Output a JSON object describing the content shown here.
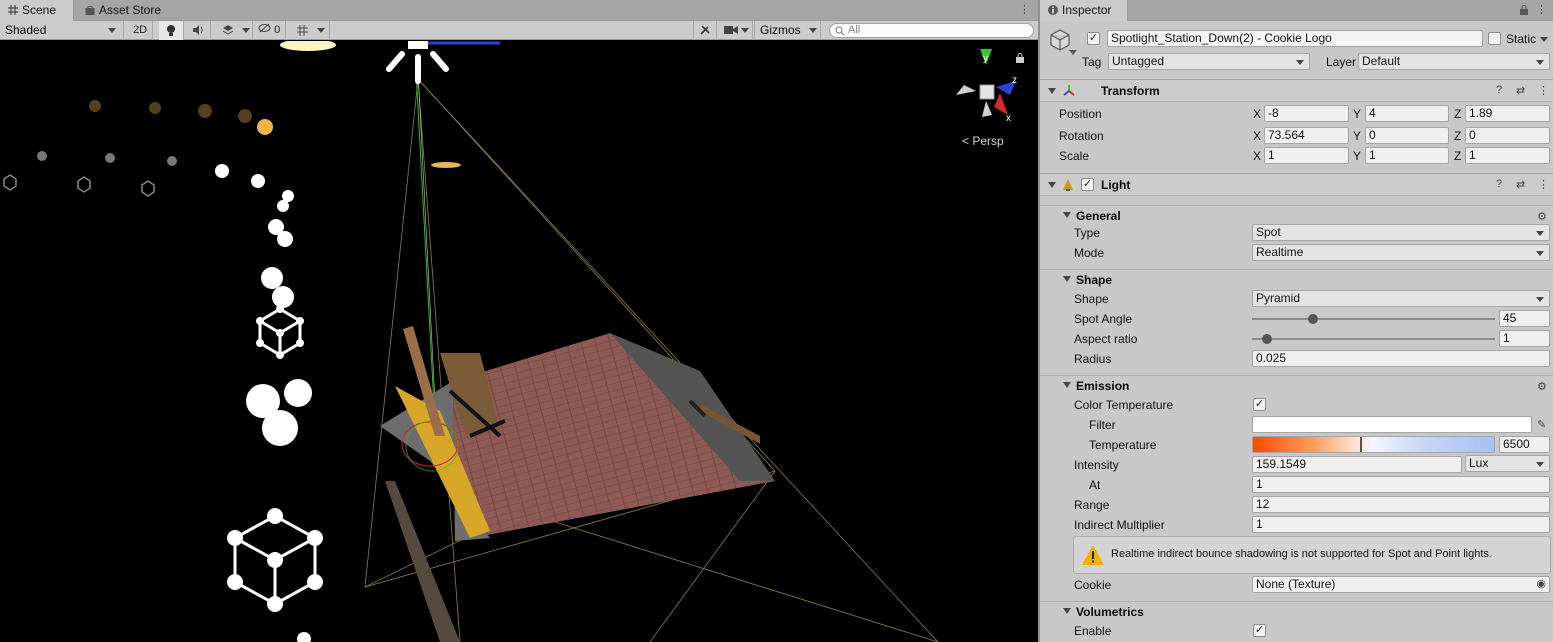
{
  "scene_panel": {
    "tabs": [
      {
        "label": "Scene",
        "icon": "grid-icon",
        "active": true
      },
      {
        "label": "Asset Store",
        "icon": "bag-icon",
        "active": false
      }
    ],
    "toolbar": {
      "draw_mode": "Shaded",
      "mode_2d": "2D",
      "hidden_count": "0",
      "gizmos": "Gizmos",
      "search_placeholder": "All"
    },
    "persp_label": "Persp",
    "gizmo_axes": {
      "x": "x",
      "y": "y",
      "z": "z"
    }
  },
  "inspector": {
    "tab_label": "Inspector",
    "object": {
      "active": true,
      "name": "Spotlight_Station_Down(2) - Cookie Logo",
      "static_label": "Static",
      "static": false,
      "tag_label": "Tag",
      "tag": "Untagged",
      "layer_label": "Layer",
      "layer": "Default"
    },
    "transform": {
      "title": "Transform",
      "position_label": "Position",
      "rotation_label": "Rotation",
      "scale_label": "Scale",
      "axis_x": "X",
      "axis_y": "Y",
      "axis_z": "Z",
      "position": {
        "x": "-8",
        "y": "4",
        "z": "1.89"
      },
      "rotation": {
        "x": "73.564",
        "y": "0",
        "z": "0"
      },
      "scale": {
        "x": "1",
        "y": "1",
        "z": "1"
      }
    },
    "light": {
      "title": "Light",
      "enabled": true,
      "general": {
        "title": "General",
        "type_label": "Type",
        "type": "Spot",
        "mode_label": "Mode",
        "mode": "Realtime"
      },
      "shape": {
        "title": "Shape",
        "shape_label": "Shape",
        "shape": "Pyramid",
        "spot_angle_label": "Spot Angle",
        "spot_angle": "45",
        "spot_angle_fraction": 0.25,
        "aspect_label": "Aspect ratio",
        "aspect": "1",
        "aspect_fraction": 0.06,
        "radius_label": "Radius",
        "radius": "0.025"
      },
      "emission": {
        "title": "Emission",
        "color_temp_label": "Color Temperature",
        "color_temp_enabled": true,
        "filter_label": "Filter",
        "temperature_label": "Temperature",
        "temperature": "6500",
        "temperature_fraction": 0.44,
        "intensity_label": "Intensity",
        "intensity": "159.1549",
        "intensity_unit": "Lux",
        "at_label": "At",
        "at": "1",
        "range_label": "Range",
        "range": "12",
        "indirect_label": "Indirect Multiplier",
        "indirect": "1",
        "warning": "Realtime indirect bounce shadowing is not supported for Spot and Point lights.",
        "cookie_label": "Cookie",
        "cookie": "None (Texture)"
      },
      "volumetrics": {
        "title": "Volumetrics",
        "enable_label": "Enable",
        "enabled": true
      }
    }
  },
  "colors": {
    "x_axis": "#d12a2a",
    "y_axis": "#3bc71f",
    "z_axis": "#2a45d8",
    "warning": "#f2b000",
    "temp_warm": "#ff4a00",
    "temp_cool": "#a7c1f0"
  }
}
